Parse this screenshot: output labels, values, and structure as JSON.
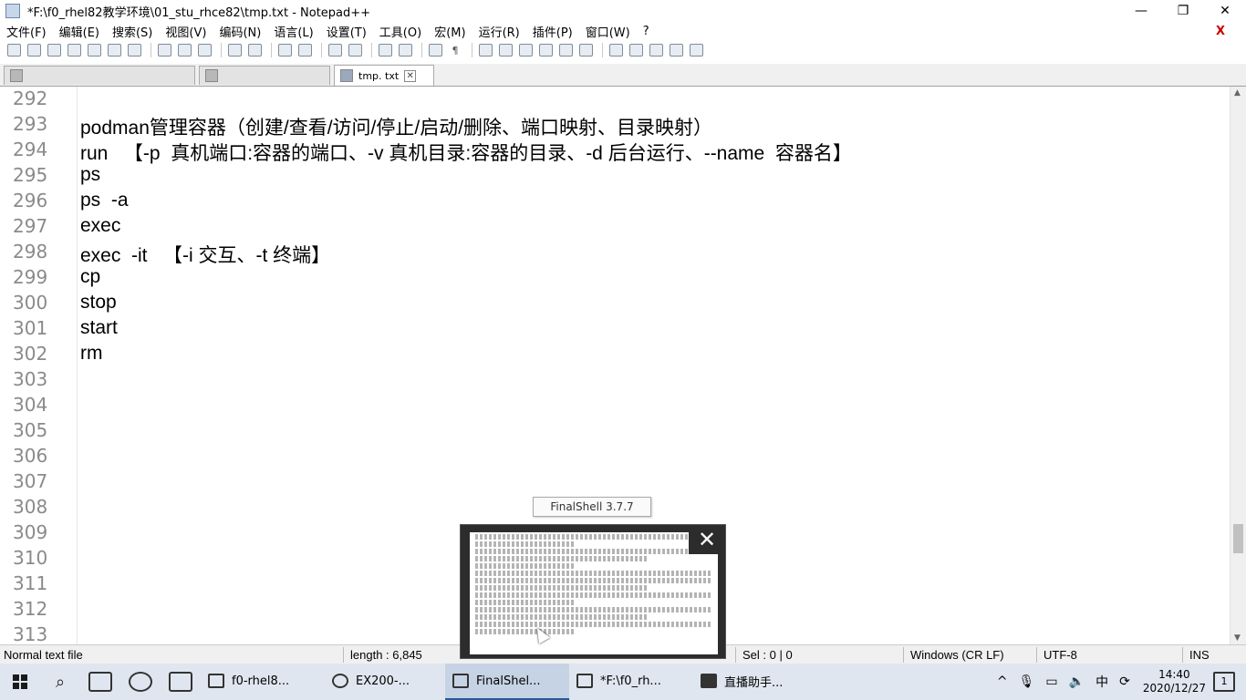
{
  "window": {
    "title": "*F:\\f0_rhel82教学环境\\01_stu_rhce82\\tmp.txt - Notepad++",
    "minimize": "—",
    "maximize": "❐",
    "close": "✕"
  },
  "menu": {
    "items": [
      "文件(F)",
      "编辑(E)",
      "搜索(S)",
      "视图(V)",
      "编码(N)",
      "语言(L)",
      "设置(T)",
      "工具(O)",
      "宏(M)",
      "运行(R)",
      "插件(P)",
      "窗口(W)",
      "?"
    ],
    "close_doc": "X"
  },
  "tabs": [
    {
      "label": "",
      "active": false
    },
    {
      "label": "",
      "active": false
    },
    {
      "label": "tmp. txt",
      "active": true
    }
  ],
  "editor": {
    "lines": [
      {
        "n": "292",
        "text": ""
      },
      {
        "n": "293",
        "text": "podman管理容器（创建/查看/访问/停止/启动/删除、端口映射、目录映射）"
      },
      {
        "n": "294",
        "text": "run   【-p  真机端口:容器的端口、-v 真机目录:容器的目录、-d 后台运行、--name  容器名】"
      },
      {
        "n": "295",
        "text": "ps"
      },
      {
        "n": "296",
        "text": "ps  -a"
      },
      {
        "n": "297",
        "text": "exec"
      },
      {
        "n": "298",
        "text": "exec  -it   【-i 交互、-t 终端】"
      },
      {
        "n": "299",
        "text": "cp"
      },
      {
        "n": "300",
        "text": "stop"
      },
      {
        "n": "301",
        "text": "start"
      },
      {
        "n": "302",
        "text": "rm"
      },
      {
        "n": "303",
        "text": ""
      },
      {
        "n": "304",
        "text": ""
      },
      {
        "n": "305",
        "text": ""
      },
      {
        "n": "306",
        "text": ""
      },
      {
        "n": "307",
        "text": ""
      },
      {
        "n": "308",
        "text": ""
      },
      {
        "n": "309",
        "text": ""
      },
      {
        "n": "310",
        "text": ""
      },
      {
        "n": "311",
        "text": ""
      },
      {
        "n": "312",
        "text": ""
      },
      {
        "n": "313",
        "text": ""
      }
    ]
  },
  "status": {
    "type": "Normal text file",
    "length": "length : 6,845",
    "sel": "Sel : 0 | 0",
    "eol": "Windows (CR LF)",
    "encoding": "UTF-8",
    "mode": "INS"
  },
  "finalshell_preview": {
    "label": "FinalShell 3.7.7",
    "close": "✕"
  },
  "taskbar": {
    "tasks": [
      {
        "label": "f0-rhel8...",
        "active": false
      },
      {
        "label": "EX200-...",
        "active": false
      },
      {
        "label": "FinalShel...",
        "active": true
      },
      {
        "label": "*F:\\f0_rh...",
        "active": false
      },
      {
        "label": "直播助手...",
        "active": false
      }
    ],
    "tray": {
      "chevron": "^",
      "ime": "中",
      "time": "14:40",
      "date": "2020/12/27",
      "notifications": "1"
    }
  },
  "colors": {
    "line_number": "#8a8a8a",
    "taskbar": "#dfe6ef",
    "active_task": "#c5d3e4"
  }
}
